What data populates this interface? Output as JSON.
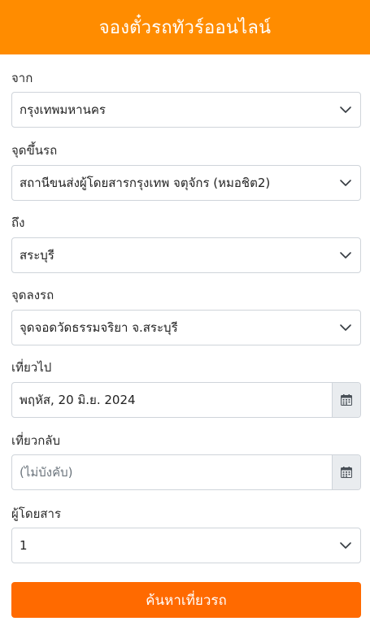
{
  "header": {
    "title": "จองตั๋วรถทัวร์ออนไลน์"
  },
  "form": {
    "from": {
      "label": "จาก",
      "value": "กรุงเทพมหานคร"
    },
    "pickup": {
      "label": "จุดขึ้นรถ",
      "value": "สถานีขนส่งผู้โดยสารกรุงเทพ จตุจักร (หมอชิต2)"
    },
    "to": {
      "label": "ถึง",
      "value": "สระบุรี"
    },
    "dropoff": {
      "label": "จุดลงรถ",
      "value": "จุดจอดวัดธรรมจริยา จ.สระบุรี"
    },
    "depart": {
      "label": "เที่ยวไป",
      "value": "พฤหัส, 20 มิ.ย. 2024"
    },
    "return": {
      "label": "เที่ยวกลับ",
      "placeholder": "(ไม่บังคับ)"
    },
    "passengers": {
      "label": "ผู้โดยสาร",
      "value": "1"
    },
    "submit_label": "ค้นหาเที่ยวรถ"
  },
  "icons": {
    "select": "chevron-down-icon",
    "date": "calendar-icon"
  },
  "colors": {
    "header": "#ff8c00",
    "submit": "#ff6a00"
  }
}
